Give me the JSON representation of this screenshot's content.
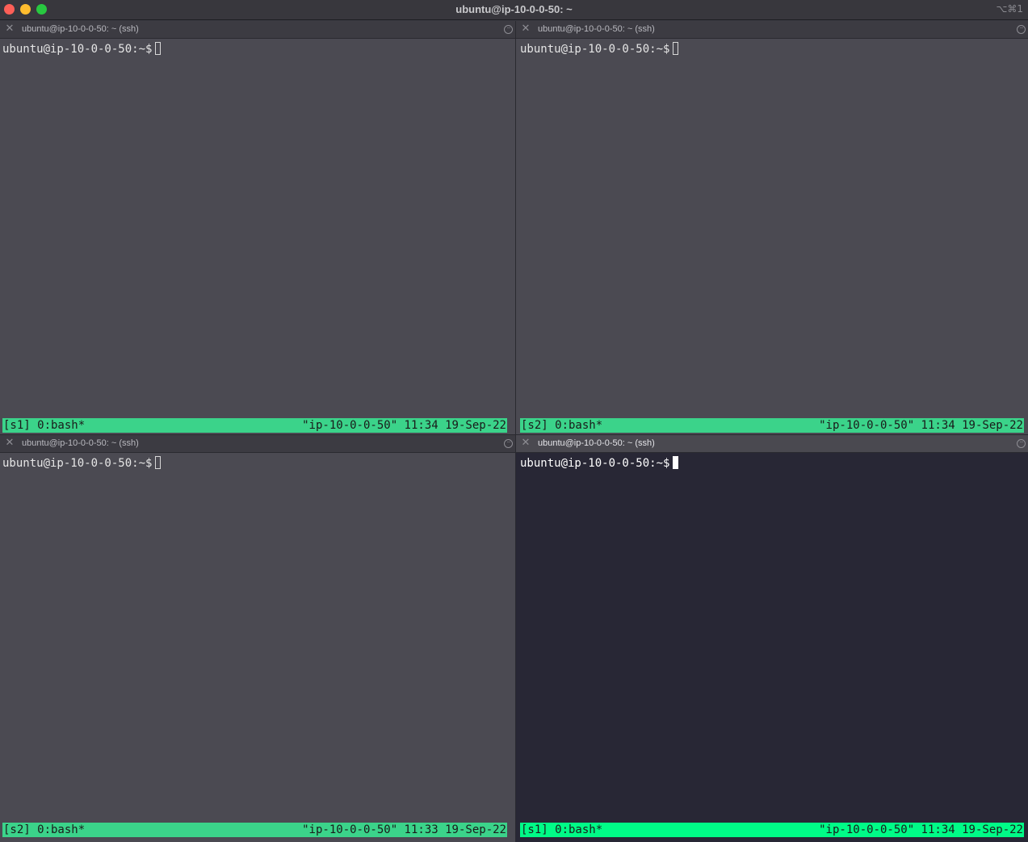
{
  "window": {
    "title": "ubuntu@ip-10-0-0-50: ~",
    "shortcut": "⌥⌘1"
  },
  "panes": [
    {
      "tab_title": "ubuntu@ip-10-0-0-50: ~ (ssh)",
      "prompt": "ubuntu@ip-10-0-0-50:~$",
      "status_left": "[s1] 0:bash*",
      "status_right": "\"ip-10-0-0-50\" 11:34 19-Sep-22",
      "active": false
    },
    {
      "tab_title": "ubuntu@ip-10-0-0-50: ~ (ssh)",
      "prompt": "ubuntu@ip-10-0-0-50:~$",
      "status_left": "[s2] 0:bash*",
      "status_right": "\"ip-10-0-0-50\" 11:34 19-Sep-22",
      "active": false
    },
    {
      "tab_title": "ubuntu@ip-10-0-0-50: ~ (ssh)",
      "prompt": "ubuntu@ip-10-0-0-50:~$",
      "status_left": "[s2] 0:bash*",
      "status_right": "\"ip-10-0-0-50\" 11:33 19-Sep-22",
      "active": false
    },
    {
      "tab_title": "ubuntu@ip-10-0-0-50: ~ (ssh)",
      "prompt": "ubuntu@ip-10-0-0-50:~$",
      "status_left": "[s1] 0:bash*",
      "status_right": "\"ip-10-0-0-50\" 11:34 19-Sep-22",
      "active": true
    }
  ],
  "colors": {
    "status_bar": "#3bd38a",
    "status_bar_active": "#00fb87",
    "pane_bg": "#4b4a52",
    "pane_bg_active": "#282735",
    "close_button": "#fe5f57",
    "minimize_button": "#febc2e",
    "zoom_button": "#28c840"
  },
  "icons": {
    "close": "close-icon",
    "pane_menu": "ellipsis-circle-icon"
  }
}
